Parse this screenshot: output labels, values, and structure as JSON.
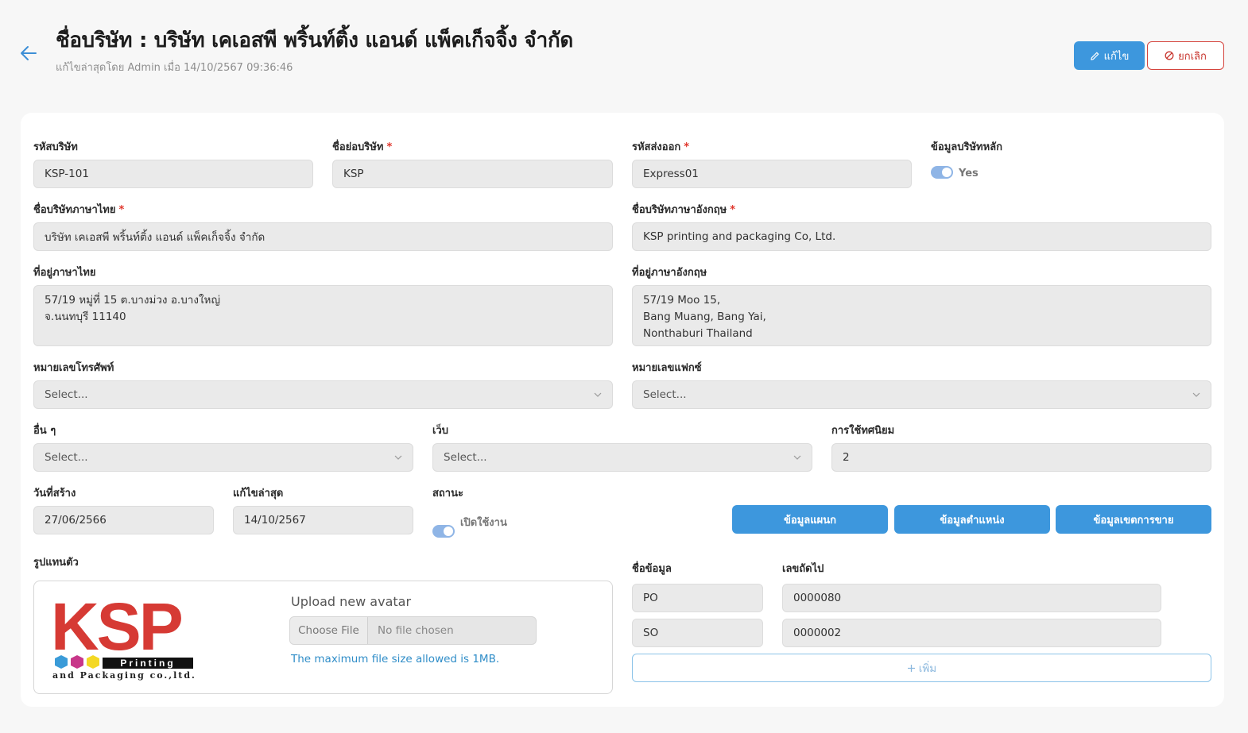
{
  "header": {
    "title": "ชื่อบริษัท : บริษัท เคเอสพี พริ้นท์ติ้ง แอนด์ แพ็คเก็จจิ้ง จำกัด",
    "subtitle": "แก้ไขล่าสุดโดย Admin เมื่อ 14/10/2567 09:36:46",
    "edit_label": "แก้ไข",
    "cancel_label": "ยกเลิก"
  },
  "form": {
    "company_code": {
      "label": "รหัสบริษัท",
      "value": "KSP-101"
    },
    "short_name": {
      "label": "ชื่อย่อบริษัท",
      "value": "KSP",
      "required": "*"
    },
    "shipping_code": {
      "label": "รหัสส่งออก",
      "value": "Express01",
      "required": "*"
    },
    "main_company": {
      "label": "ข้อมูลบริษัทหลัก",
      "toggle_text": "Yes",
      "on": true
    },
    "name_th": {
      "label": "ชื่อบริษัทภาษาไทย",
      "value": "บริษัท เคเอสพี พริ้นท์ติ้ง แอนด์ แพ็คเก็จจิ้ง จำกัด",
      "required": "*"
    },
    "name_en": {
      "label": "ชื่อบริษัทภาษาอังกฤษ",
      "value": "KSP printing and packaging Co, Ltd.",
      "required": "*"
    },
    "address_th": {
      "label": "ที่อยู่ภาษาไทย",
      "lines": [
        "57/19 หมู่ที่ 15 ต.บางม่วง อ.บางใหญ่",
        "จ.นนทบุรี 11140"
      ]
    },
    "address_en": {
      "label": "ที่อยู่ภาษาอังกฤษ",
      "lines": [
        "57/19 Moo 15,",
        "Bang Muang, Bang Yai,",
        "Nonthaburi Thailand"
      ]
    },
    "phone": {
      "label": "หมายเลขโทรศัพท์",
      "placeholder": "Select..."
    },
    "fax": {
      "label": "หมายเลขแฟกซ์",
      "placeholder": "Select..."
    },
    "other": {
      "label": "อื่น ๆ",
      "placeholder": "Select..."
    },
    "web": {
      "label": "เว็บ",
      "placeholder": "Select..."
    },
    "decimal": {
      "label": "การใช้ทศนิยม",
      "value": "2"
    },
    "created": {
      "label": "วันที่สร้าง",
      "value": "27/06/2566"
    },
    "updated": {
      "label": "แก้ไขล่าสุด",
      "value": "14/10/2567"
    },
    "status": {
      "label": "สถานะ",
      "toggle_text": "เปิดใช้งาน",
      "on": true
    },
    "dept_button": "ข้อมูลแผนก",
    "position_button": "ข้อมูลตำแหน่ง",
    "sales_zone_button": "ข้อมูลเขตการขาย"
  },
  "avatar": {
    "label": "รูปแทนตัว",
    "logo_text": "KSP",
    "logo_sub1": "Printing",
    "logo_sub2": "and Packaging co.,ltd.",
    "upload_title": "Upload new avatar",
    "choose_label": "Choose File",
    "no_file_label": "No file chosen",
    "hint": "The maximum file size allowed is 1MB."
  },
  "running": {
    "name_header": "ชื่อข้อมูล",
    "next_header": "เลขถัดไป",
    "rows": [
      {
        "name": "PO",
        "next": "0000080"
      },
      {
        "name": "SO",
        "next": "0000002"
      }
    ],
    "add_label": "เพิ่ม"
  },
  "colors": {
    "primary": "#3d97dd",
    "danger": "#d5453e",
    "logo_red": "#d63a34"
  }
}
